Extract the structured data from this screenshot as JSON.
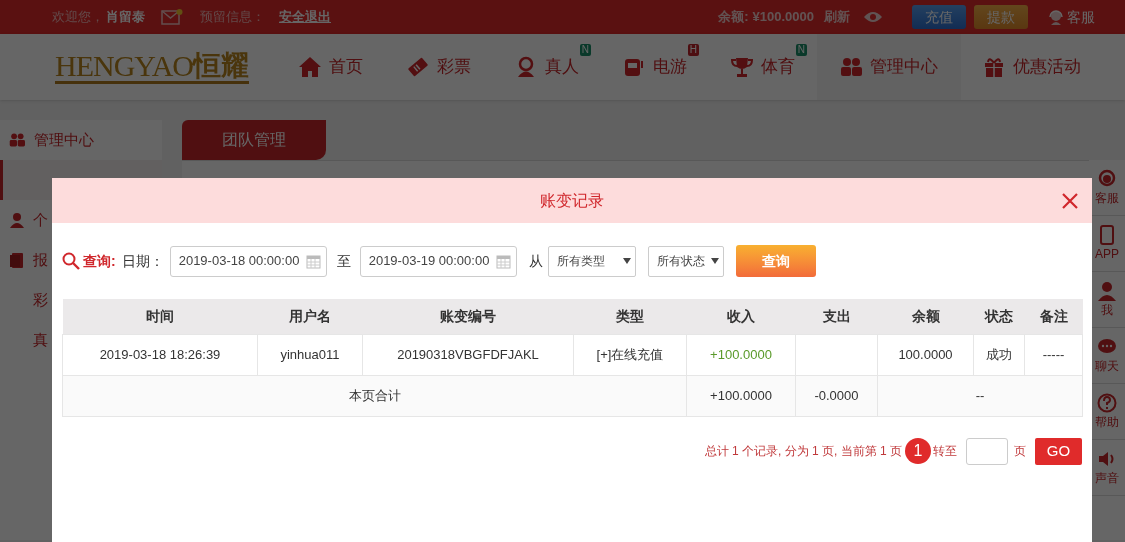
{
  "top_bar": {
    "welcome": "欢迎您，",
    "username": "肖留泰",
    "mail_unread": true,
    "notice_label": "预留信息：",
    "logout": "安全退出",
    "balance_label": "余额:",
    "balance": "¥100.0000",
    "refresh": "刷新",
    "deposit": "充值",
    "withdraw": "提款",
    "service": "客服"
  },
  "logo": {
    "latin": "HENGYAO",
    "cjk": "恒耀"
  },
  "nav": [
    {
      "label": "首页",
      "selected": false
    },
    {
      "label": "彩票",
      "selected": false
    },
    {
      "label": "真人",
      "badge": "N",
      "color": "#0a392a",
      "selected": false
    },
    {
      "label": "电游",
      "badge": "H",
      "color": "#4d0e11",
      "selected": false
    },
    {
      "label": "体育",
      "badge": "N",
      "color": "#0a392a",
      "selected": false
    },
    {
      "label": "管理中心",
      "selected": true
    },
    {
      "label": "优惠活动",
      "selected": false
    }
  ],
  "sidebar": {
    "title": "管理中心",
    "items": [
      {
        "kind": "sub",
        "selected": true
      },
      {
        "kind": "section",
        "label": "个",
        "selected": false
      },
      {
        "kind": "section",
        "label": "报",
        "selected": false
      },
      {
        "kind": "sub",
        "label": "彩",
        "selected": false
      },
      {
        "kind": "sub",
        "label": "真",
        "selected": false
      }
    ]
  },
  "page_tab": "团队管理",
  "float_bar": [
    "客服",
    "APP",
    "我",
    "聊天",
    "帮助",
    "声音"
  ],
  "modal": {
    "title": "账变记录",
    "query": {
      "label": "查询:",
      "date_label": "日期：",
      "start": "2019-03-18 00:00:00",
      "to": "至",
      "end": "2019-03-19 00:00:00",
      "from": "从",
      "type_select": "所有类型",
      "status_select": "所有状态",
      "button": "查询"
    },
    "table": {
      "columns": [
        {
          "label": "时间",
          "kind": "text"
        },
        {
          "label": "用户名",
          "kind": "text"
        },
        {
          "label": "账变编号",
          "kind": "text"
        },
        {
          "label": "类型",
          "kind": "text"
        },
        {
          "label": "收入",
          "kind": "income"
        },
        {
          "label": "支出",
          "kind": "text"
        },
        {
          "label": "余额",
          "kind": "text"
        },
        {
          "label": "状态",
          "kind": "text"
        },
        {
          "label": "备注",
          "kind": "text"
        }
      ],
      "rows": [
        [
          "2019-03-18 18:26:39",
          "yinhua011",
          "20190318VBGFDFJAKL",
          "[+]在线充值",
          "+100.0000",
          null,
          "100.0000",
          "成功",
          "-----"
        ]
      ],
      "totals": {
        "label": "本页合计",
        "income": "+100.0000",
        "expense": "-0.0000",
        "rest": "--"
      }
    },
    "pagination": {
      "summary": "总计 1 个记录, 分为 1 页, 当前第 1 页",
      "pages": [
        {
          "label": "1",
          "selected": true
        }
      ],
      "goto": "转至",
      "unit": "页",
      "go": "GO"
    }
  }
}
